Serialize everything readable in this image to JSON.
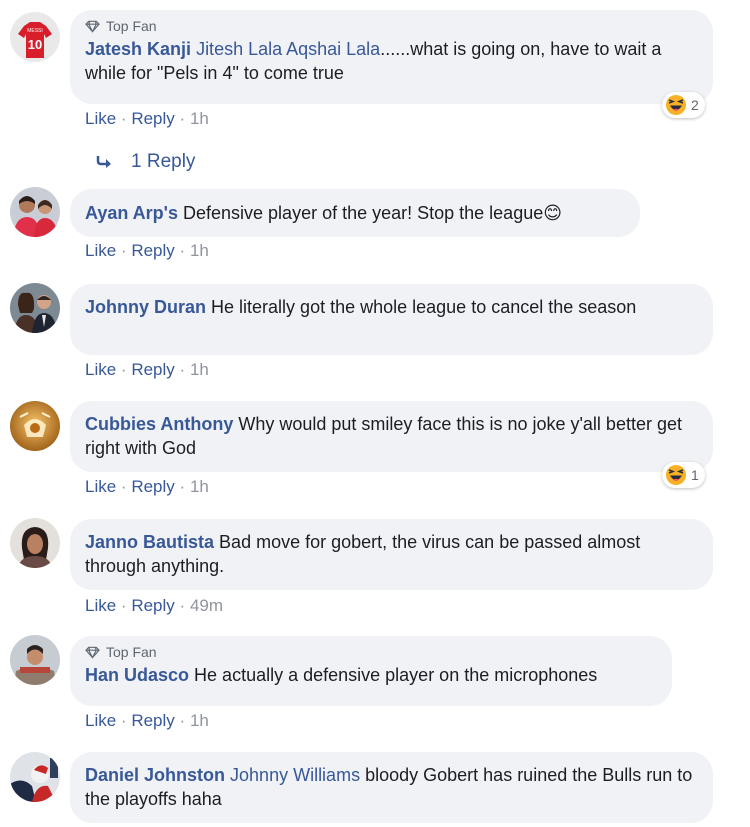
{
  "colors": {
    "link": "#385898",
    "bubble": "#f0f2f5",
    "meta": "#90949c"
  },
  "actions": {
    "like": "Like",
    "reply": "Reply",
    "sep": "·"
  },
  "comments": [
    {
      "badge": "Top Fan",
      "author": "Jatesh Kanji",
      "mention": "Jitesh Lala Aqshai Lala",
      "text": "......what is going on, have to wait a while for \"Pels in 4\" to come true",
      "time": "1h",
      "reaction": {
        "icon": "haha-emoji-icon",
        "count": "2"
      },
      "replies": "1 Reply"
    },
    {
      "author": "Ayan Arp's",
      "text": "Defensive player of the year! Stop the league😊",
      "time": "1h"
    },
    {
      "author": "Johnny Duran",
      "text": "He literally got the whole league to cancel the season",
      "time": "1h"
    },
    {
      "author": "Cubbies Anthony",
      "text": "Why would put smiley face this is no joke y'all better get right with God",
      "time": "1h",
      "reaction": {
        "icon": "haha-emoji-icon",
        "count": "1"
      }
    },
    {
      "author": "Janno Bautista",
      "text": "Bad move for gobert, the virus can be passed almost through anything.",
      "time": "49m"
    },
    {
      "badge": "Top Fan",
      "author": "Han Udasco",
      "text": "He actually a defensive player on the microphones",
      "time": "1h"
    },
    {
      "author": "Daniel Johnston",
      "mention": "Johnny Williams",
      "text": "bloody Gobert has ruined the Bulls run to the playoffs haha"
    }
  ]
}
